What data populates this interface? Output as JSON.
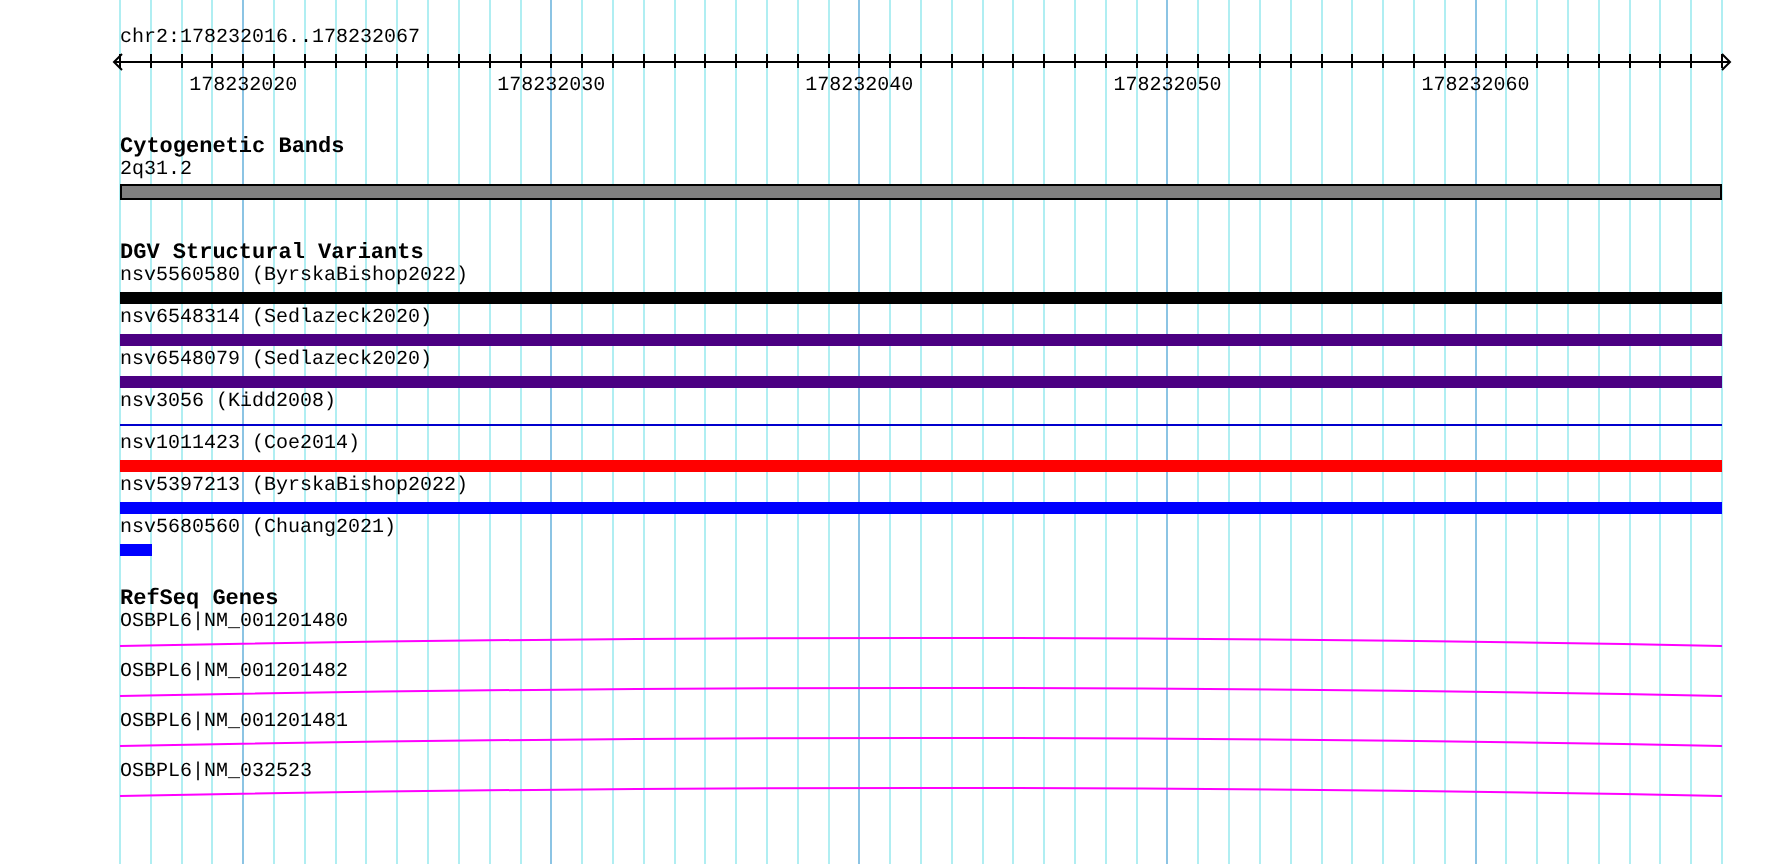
{
  "ruler": {
    "range": "chr2:178232016..178232067",
    "tick_labels": [
      "178232020",
      "178232030",
      "178232040",
      "178232050",
      "178232060"
    ]
  },
  "cytogenetic_bands": {
    "title": "Cytogenetic Bands",
    "band": "2q31.2"
  },
  "dgv_variants": {
    "title": "DGV Structural Variants",
    "items": [
      {
        "label": "nsv5560580 (ByrskaBishop2022)",
        "kind": "bar",
        "color": "#000000"
      },
      {
        "label": "nsv6548314 (Sedlazeck2020)",
        "kind": "bar",
        "color": "#4b0082"
      },
      {
        "label": "nsv6548079 (Sedlazeck2020)",
        "kind": "bar",
        "color": "#4b0082"
      },
      {
        "label": "nsv3056 (Kidd2008)",
        "kind": "line",
        "color": "#0000cd"
      },
      {
        "label": "nsv1011423 (Coe2014)",
        "kind": "bar",
        "color": "#ff0000"
      },
      {
        "label": "nsv5397213 (ByrskaBishop2022)",
        "kind": "bar",
        "color": "#0000ff"
      },
      {
        "label": "nsv5680560 (Chuang2021)",
        "kind": "stub",
        "color": "#0000ff"
      }
    ]
  },
  "refseq_genes": {
    "title": "RefSeq Genes",
    "items": [
      {
        "label": "OSBPL6|NM_001201480"
      },
      {
        "label": "OSBPL6|NM_001201482"
      },
      {
        "label": "OSBPL6|NM_001201481"
      },
      {
        "label": "OSBPL6|NM_032523"
      }
    ]
  }
}
